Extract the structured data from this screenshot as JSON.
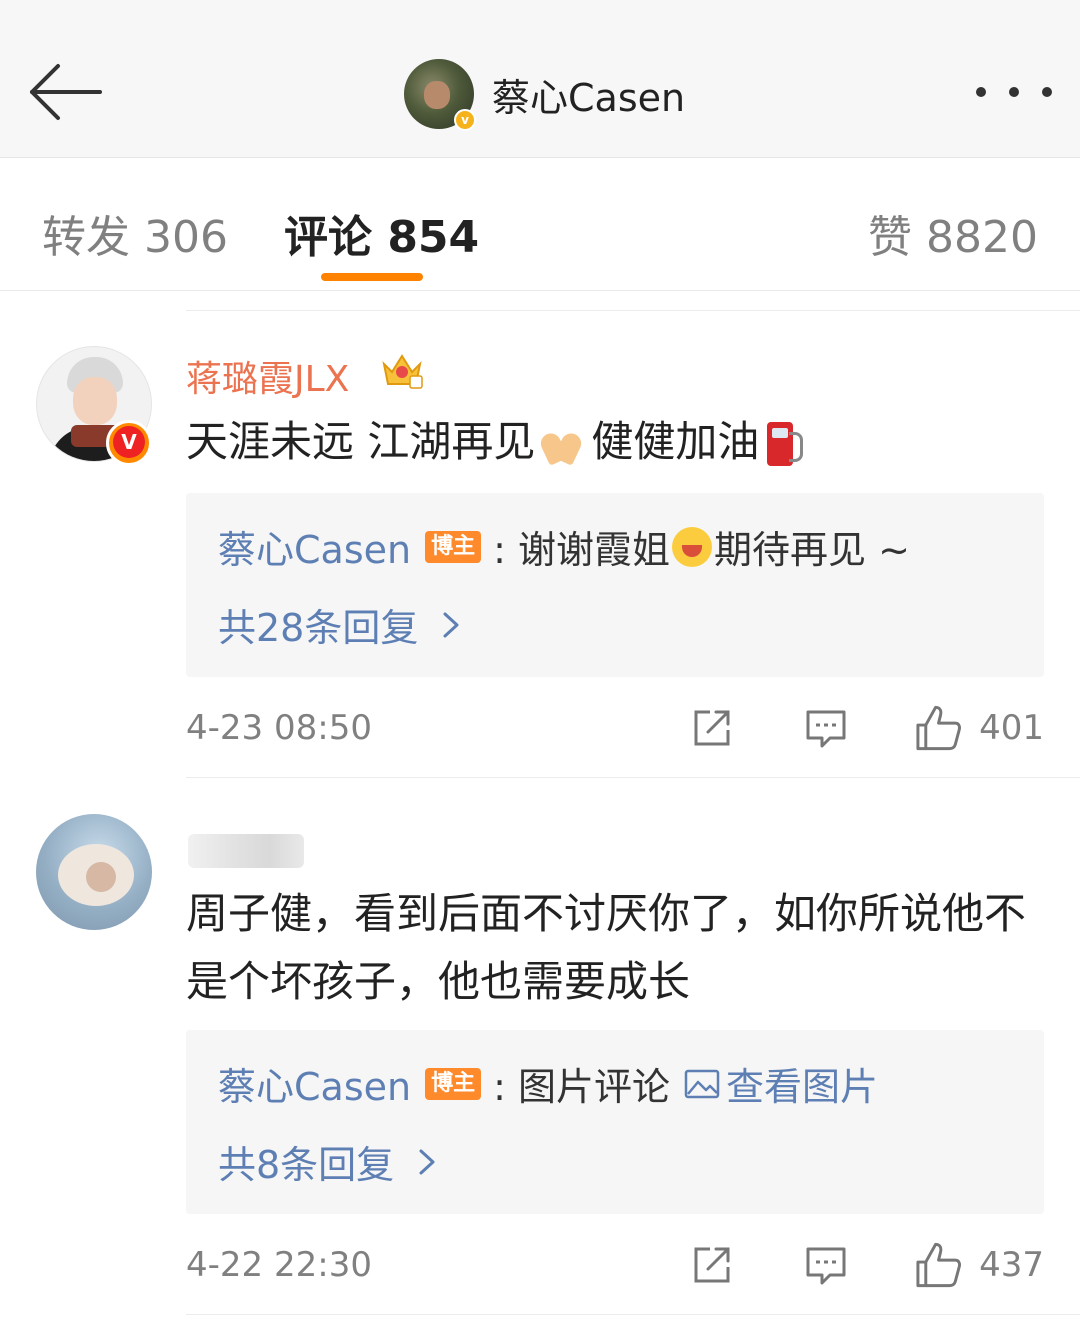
{
  "header": {
    "title": "蔡心Casen",
    "avatar_badge": "v"
  },
  "tabs": {
    "repost": "转发 306",
    "comments": "评论 854",
    "likes": "赞 8820"
  },
  "comments": [
    {
      "username": "蒋璐霞JLX",
      "avatar_badge": "V",
      "text_part1": "天涯未远 江湖再见",
      "text_part2": "健健加油",
      "reply": {
        "name": "蔡心Casen",
        "badge": "博主",
        "text_prefix": ": 谢谢霞姐",
        "text_suffix": "期待再见 ~",
        "count": "共28条回复"
      },
      "time": "4-23 08:50",
      "likes": "401"
    },
    {
      "username": "",
      "text": "周子健，看到后面不讨厌你了，如你所说他不是个坏孩子，他也需要成长",
      "reply": {
        "name": "蔡心Casen",
        "badge": "博主",
        "text_prefix": ": 图片评论",
        "view_image": "查看图片",
        "count": "共8条回复"
      },
      "time": "4-22 22:30",
      "likes": "437"
    }
  ],
  "icons": {
    "back": "arrow-left-icon",
    "more": "more-dots-icon",
    "share": "share-icon",
    "comment": "comment-icon",
    "like": "thumbs-up-icon",
    "chevron": "chevron-right-icon",
    "image": "image-icon"
  },
  "colors": {
    "accent": "#ff8200",
    "link": "#5d7fb3",
    "vip_name": "#eb7350",
    "badge": "#ff8a2b"
  }
}
